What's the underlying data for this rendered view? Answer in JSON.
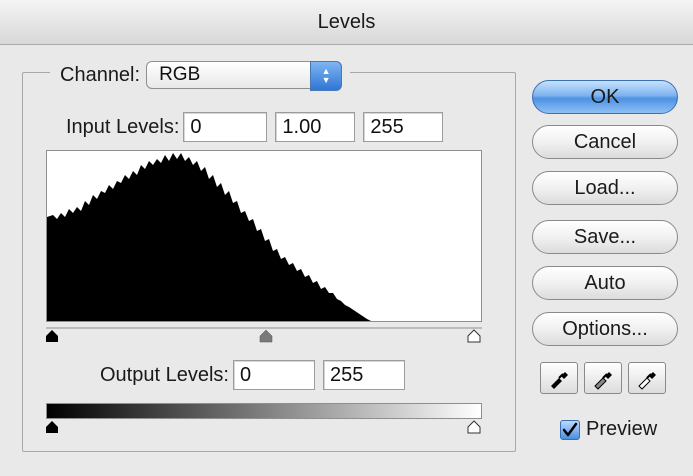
{
  "window": {
    "title": "Levels"
  },
  "channel": {
    "label": "Channel:",
    "value": "RGB"
  },
  "input_levels": {
    "label": "Input Levels:",
    "black": "0",
    "gamma": "1.00",
    "white": "255"
  },
  "histogram": {
    "shadow_slider": 0,
    "midtone_slider": 1.0,
    "highlight_slider": 255
  },
  "output_levels": {
    "label": "Output Levels:",
    "black": "0",
    "white": "255"
  },
  "buttons": {
    "ok": "OK",
    "cancel": "Cancel",
    "load": "Load...",
    "save": "Save...",
    "auto": "Auto",
    "options": "Options..."
  },
  "eyedroppers": [
    "black-point-eyedropper-icon",
    "gray-point-eyedropper-icon",
    "white-point-eyedropper-icon"
  ],
  "preview": {
    "label": "Preview",
    "checked": true
  },
  "colors": {
    "accent": "#4d92e3",
    "background": "#e9e9e9"
  }
}
